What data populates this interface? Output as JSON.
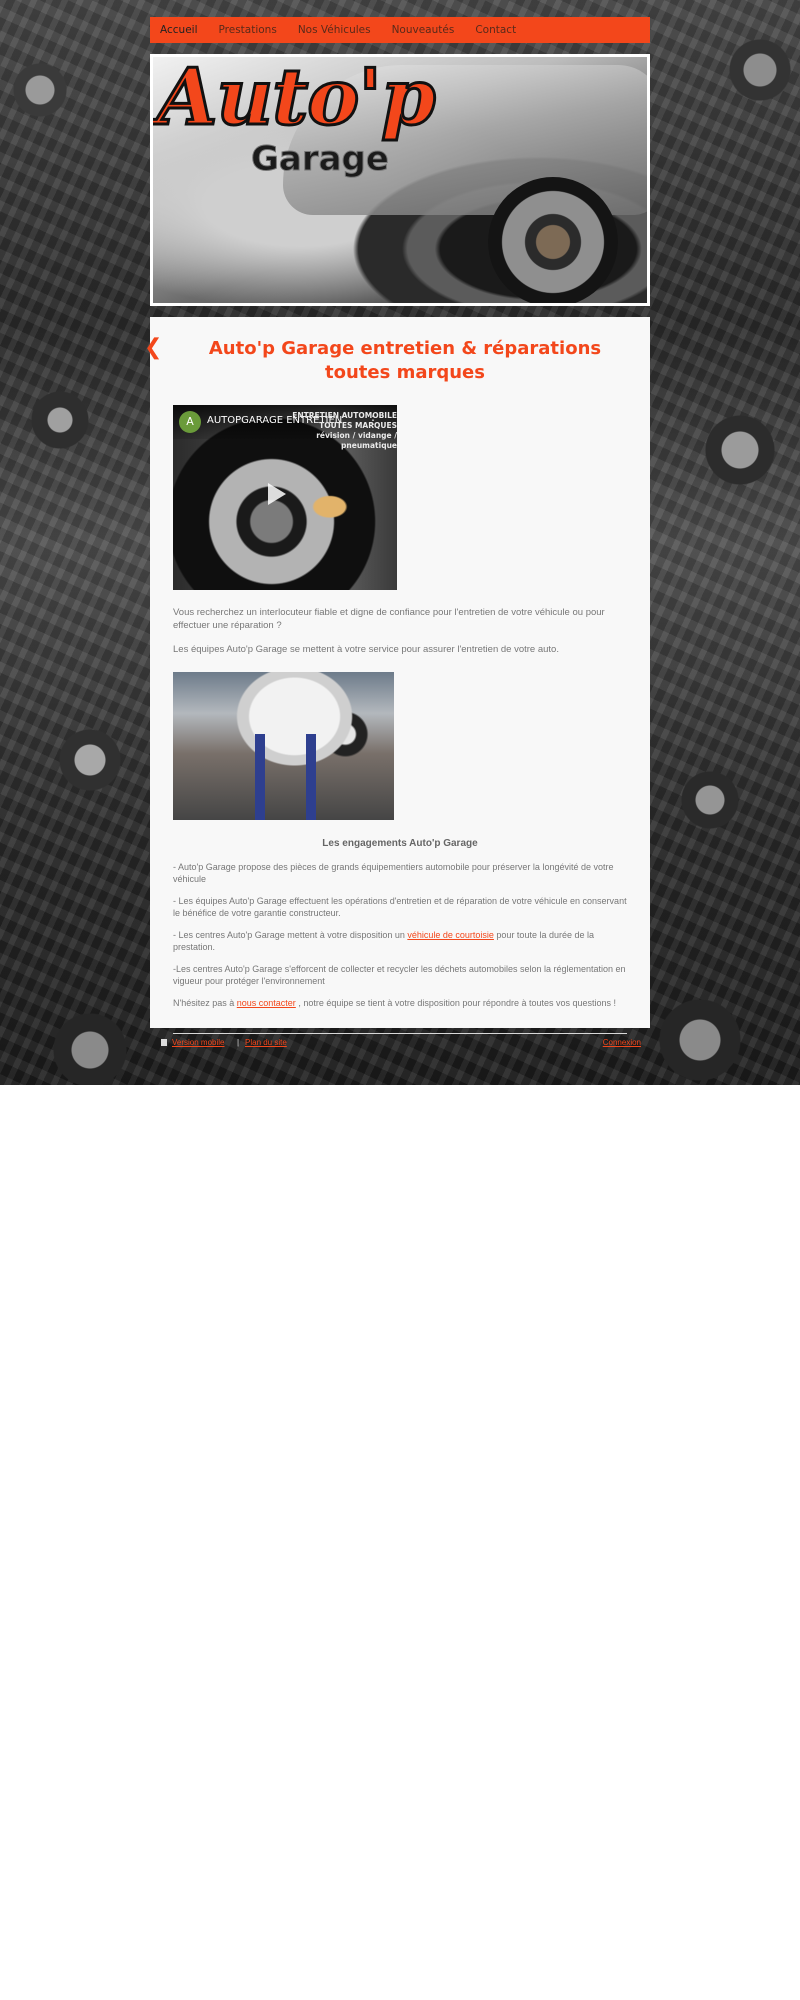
{
  "nav": {
    "items": [
      {
        "label": "Accueil",
        "active": true
      },
      {
        "label": "Prestations",
        "active": false
      },
      {
        "label": "Nos Véhicules",
        "active": false
      },
      {
        "label": "Nouveautés",
        "active": false
      },
      {
        "label": "Contact",
        "active": false
      }
    ]
  },
  "banner": {
    "logo_main": "Auto'p",
    "logo_sub": "Garage"
  },
  "main": {
    "back_icon": "chevron-left-icon",
    "title": "Auto'p Garage entretien & réparations toutes marques",
    "video": {
      "avatar_letter": "A",
      "title": "AUTOPGARAGE ENTRETIEN",
      "menu_glyph": "⋮",
      "overlay_line1": "ENTRETIEN AUTOMOBILE",
      "overlay_line2": "TOUTES MARQUES",
      "overlay_line3": "révision / vidange / pneumatique"
    },
    "intro_p1": "Vous recherchez un interlocuteur fiable et digne de confiance pour l'entretien de votre véhicule ou pour effectuer une réparation ?",
    "intro_p2": "Les équipes Auto'p Garage se mettent à votre service pour assurer l'entretien de votre auto.",
    "engagements_heading": "Les engagements Auto'p Garage",
    "b1": "- Auto'p Garage propose des pièces de grands équipementiers automobile pour préserver la longévité de votre véhicule",
    "b2": "- Les équipes Auto'p Garage effectuent les opérations d'entretien et de réparation de votre véhicule en conservant le bénéfice de votre garantie constructeur.",
    "b3_pre": "- Les centres Auto'p Garage mettent à votre disposition un ",
    "b3_link": "véhicule de courtoisie",
    "b3_post": " pour toute la durée de la prestation.",
    "b4": "-Les centres Auto'p  Garage s'efforcent de collecter et recycler les déchets automobiles selon la réglementation en vigueur pour protéger l'environnement",
    "b5_pre": "N'hésitez pas à ",
    "b5_link": "nous contacter",
    "b5_post": " , notre équipe se tient à votre disposition pour répondre à toutes vos questions !"
  },
  "footer": {
    "mobile_link": "Version mobile",
    "separator": "|",
    "plan_link": "Plan du site",
    "login_link": "Connexion"
  },
  "colors": {
    "accent": "#f3471b",
    "panel": "#f8f8f8",
    "text": "#777777"
  }
}
